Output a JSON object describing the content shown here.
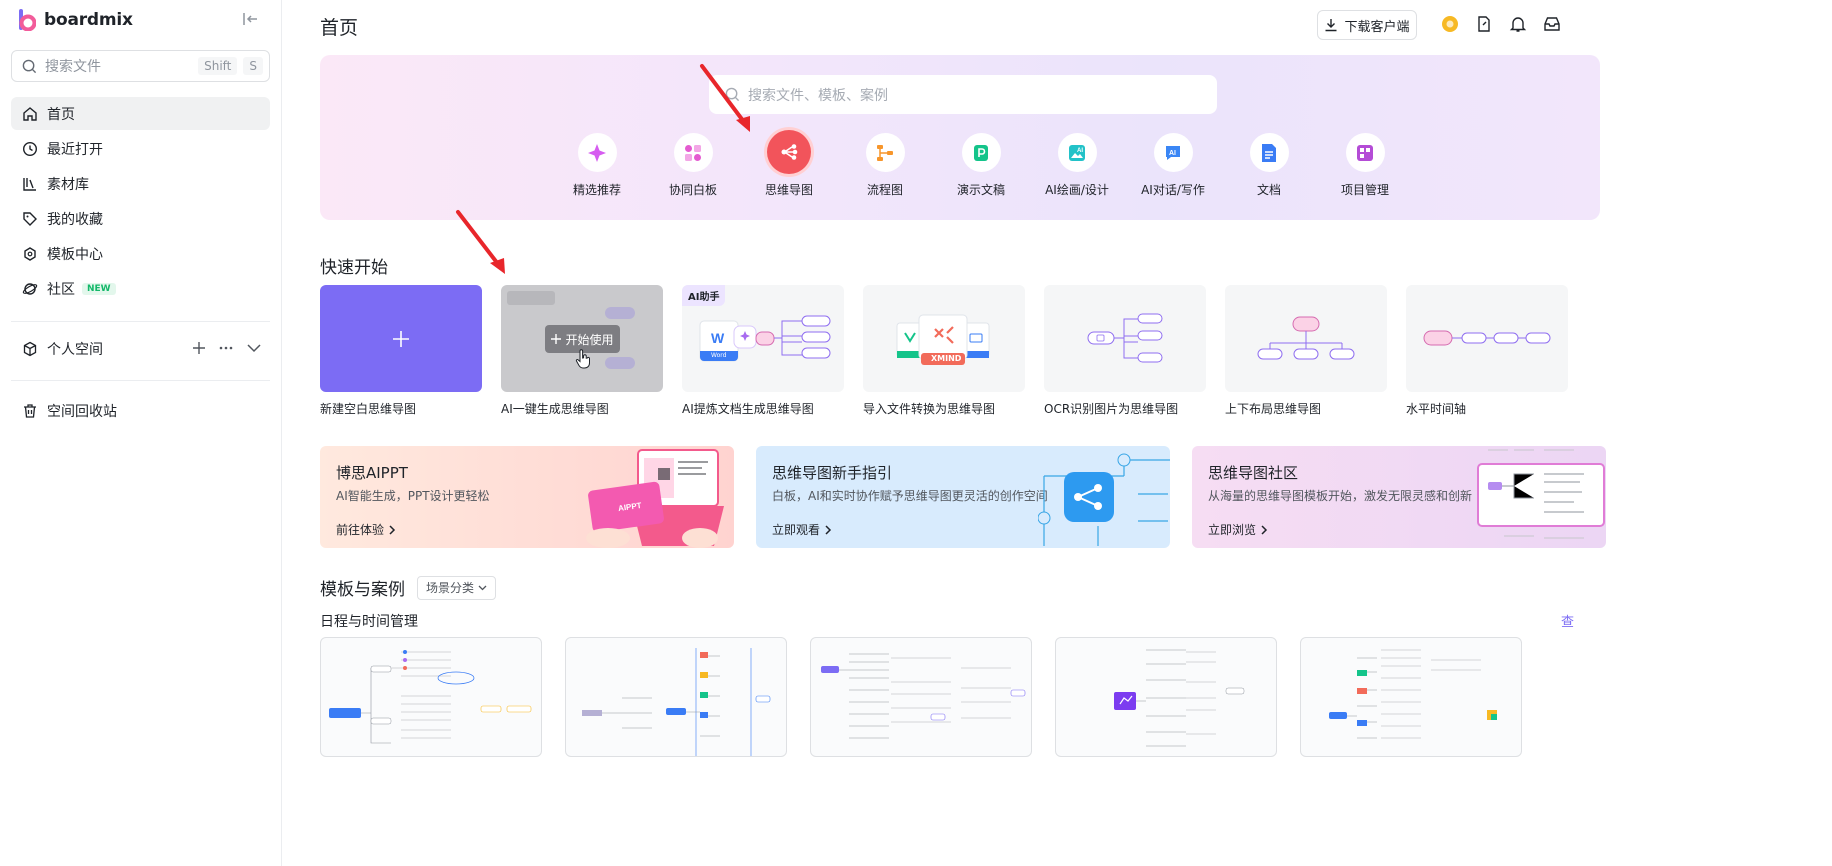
{
  "sidebar": {
    "brand": "boardmix",
    "search": {
      "placeholder": "搜索文件",
      "kbd1": "Shift",
      "kbd2": "S"
    },
    "items": [
      {
        "label": "首页"
      },
      {
        "label": "最近打开"
      },
      {
        "label": "素材库"
      },
      {
        "label": "我的收藏"
      },
      {
        "label": "模板中心"
      },
      {
        "label": "社区",
        "badge": "NEW"
      }
    ],
    "personal_space": "个人空间",
    "trash": "空间回收站"
  },
  "header": {
    "title": "首页",
    "download": "下载客户端"
  },
  "hero": {
    "search_placeholder": "搜索文件、模板、案例",
    "categories": [
      {
        "label": "精选推荐"
      },
      {
        "label": "协同白板"
      },
      {
        "label": "思维导图"
      },
      {
        "label": "流程图"
      },
      {
        "label": "演示文稿"
      },
      {
        "label": "AI绘画/设计"
      },
      {
        "label": "AI对话/写作"
      },
      {
        "label": "文档"
      },
      {
        "label": "项目管理"
      }
    ]
  },
  "quick_start": {
    "title": "快速开始",
    "cards": [
      {
        "label": "新建空白思维导图"
      },
      {
        "label": "AI一键生成思维导图",
        "button": "开始使用"
      },
      {
        "label": "AI提炼文档生成思维导图",
        "tag": "AI助手",
        "word": "Word"
      },
      {
        "label": "导入文件转换为思维导图",
        "xmind": "XMIND"
      },
      {
        "label": "OCR识别图片为思维导图"
      },
      {
        "label": "上下布局思维导图"
      },
      {
        "label": "水平时间轴"
      }
    ]
  },
  "banners": [
    {
      "title": "博思AIPPT",
      "subtitle": "AI智能生成，PPT设计更轻松",
      "link": "前往体验"
    },
    {
      "title": "思维导图新手指引",
      "subtitle": "白板，AI和实时协作赋予思维导图更灵活的创作空间",
      "link": "立即观看"
    },
    {
      "title": "思维导图社区",
      "subtitle": "从海量的思维导图模板开始，激发无限灵感和创新",
      "link": "立即浏览"
    }
  ],
  "templates": {
    "title": "模板与案例",
    "filter": "场景分类",
    "subtitle": "日程与时间管理",
    "more": "查"
  },
  "colors": {
    "accent": "#7c6cf4",
    "active_cat": "#f2545b",
    "arrow": "#e8262b"
  }
}
